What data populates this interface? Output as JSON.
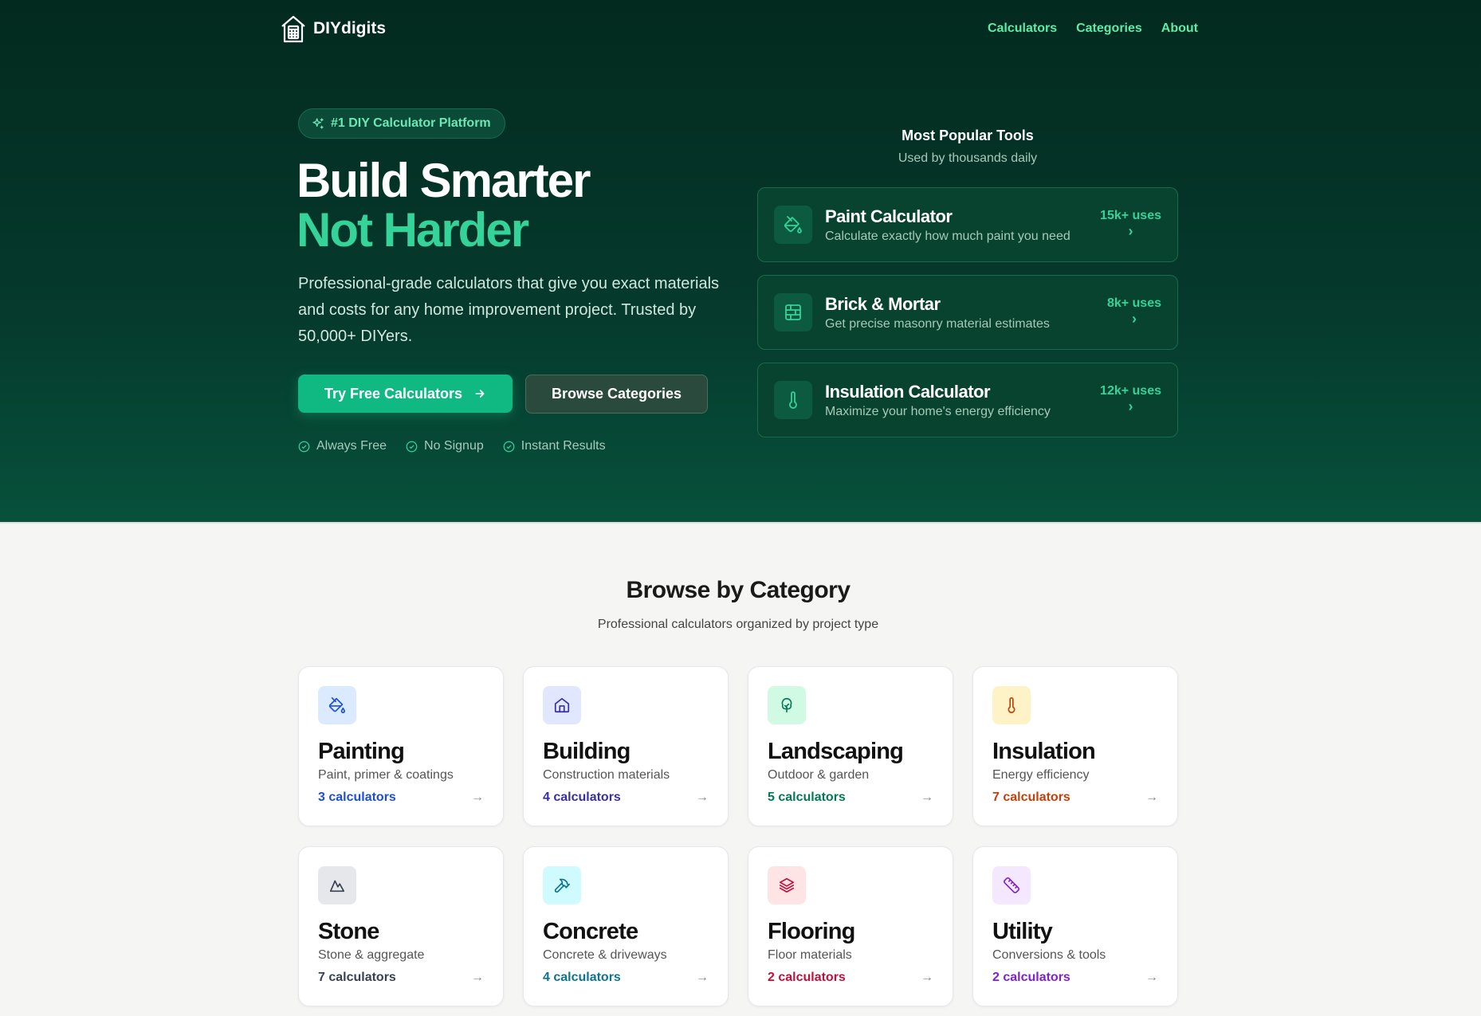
{
  "brand": {
    "name": "DIYdigits"
  },
  "nav": {
    "links": [
      "Calculators",
      "Categories",
      "About"
    ]
  },
  "hero": {
    "badge": "#1 DIY Calculator Platform",
    "title_line1": "Build Smarter",
    "title_line2": "Not Harder",
    "lead": "Professional-grade calculators that give you exact materials and costs for any home improvement project. Trusted by 50,000+ DIYers.",
    "primary_cta": "Try Free Calculators",
    "secondary_cta": "Browse Categories",
    "checks": [
      "Always Free",
      "No Signup",
      "Instant Results"
    ]
  },
  "popular": {
    "title": "Most Popular Tools",
    "subtitle": "Used by thousands daily",
    "tools": [
      {
        "name": "Paint Calculator",
        "desc": "Calculate exactly how much paint you need",
        "uses": "15k+ uses",
        "icon": "paint-bucket-icon"
      },
      {
        "name": "Brick & Mortar",
        "desc": "Get precise masonry material estimates",
        "uses": "8k+ uses",
        "icon": "brick-wall-icon"
      },
      {
        "name": "Insulation Calculator",
        "desc": "Maximize your home's energy efficiency",
        "uses": "12k+ uses",
        "icon": "thermometer-icon"
      }
    ]
  },
  "categories": {
    "title": "Browse by Category",
    "subtitle": "Professional calculators organized by project type",
    "items": [
      {
        "name": "Painting",
        "desc": "Paint, primer & coatings",
        "count": "3 calculators",
        "accent": "#1d4ed8",
        "bg": "#dbeafe",
        "icon": "paint-bucket-icon"
      },
      {
        "name": "Building",
        "desc": "Construction materials",
        "count": "4 calculators",
        "accent": "#3730a3",
        "bg": "#e0e7ff",
        "icon": "house-icon"
      },
      {
        "name": "Landscaping",
        "desc": "Outdoor & garden",
        "count": "5 calculators",
        "accent": "#047857",
        "bg": "#d1fae5",
        "icon": "tree-icon"
      },
      {
        "name": "Insulation",
        "desc": "Energy efficiency",
        "count": "7 calculators",
        "accent": "#c2410c",
        "bg": "#fef3c7",
        "icon": "thermometer-icon"
      },
      {
        "name": "Stone",
        "desc": "Stone & aggregate",
        "count": "7 calculators",
        "accent": "#374151",
        "bg": "#e5e7eb",
        "icon": "mountain-icon"
      },
      {
        "name": "Concrete",
        "desc": "Concrete & driveways",
        "count": "4 calculators",
        "accent": "#0e7490",
        "bg": "#cffafe",
        "icon": "hammer-icon"
      },
      {
        "name": "Flooring",
        "desc": "Floor materials",
        "count": "2 calculators",
        "accent": "#be123c",
        "bg": "#ffe4e6",
        "icon": "layers-icon"
      },
      {
        "name": "Utility",
        "desc": "Conversions & tools",
        "count": "2 calculators",
        "accent": "#7e22ce",
        "bg": "#f3e8ff",
        "icon": "ruler-icon"
      }
    ]
  }
}
